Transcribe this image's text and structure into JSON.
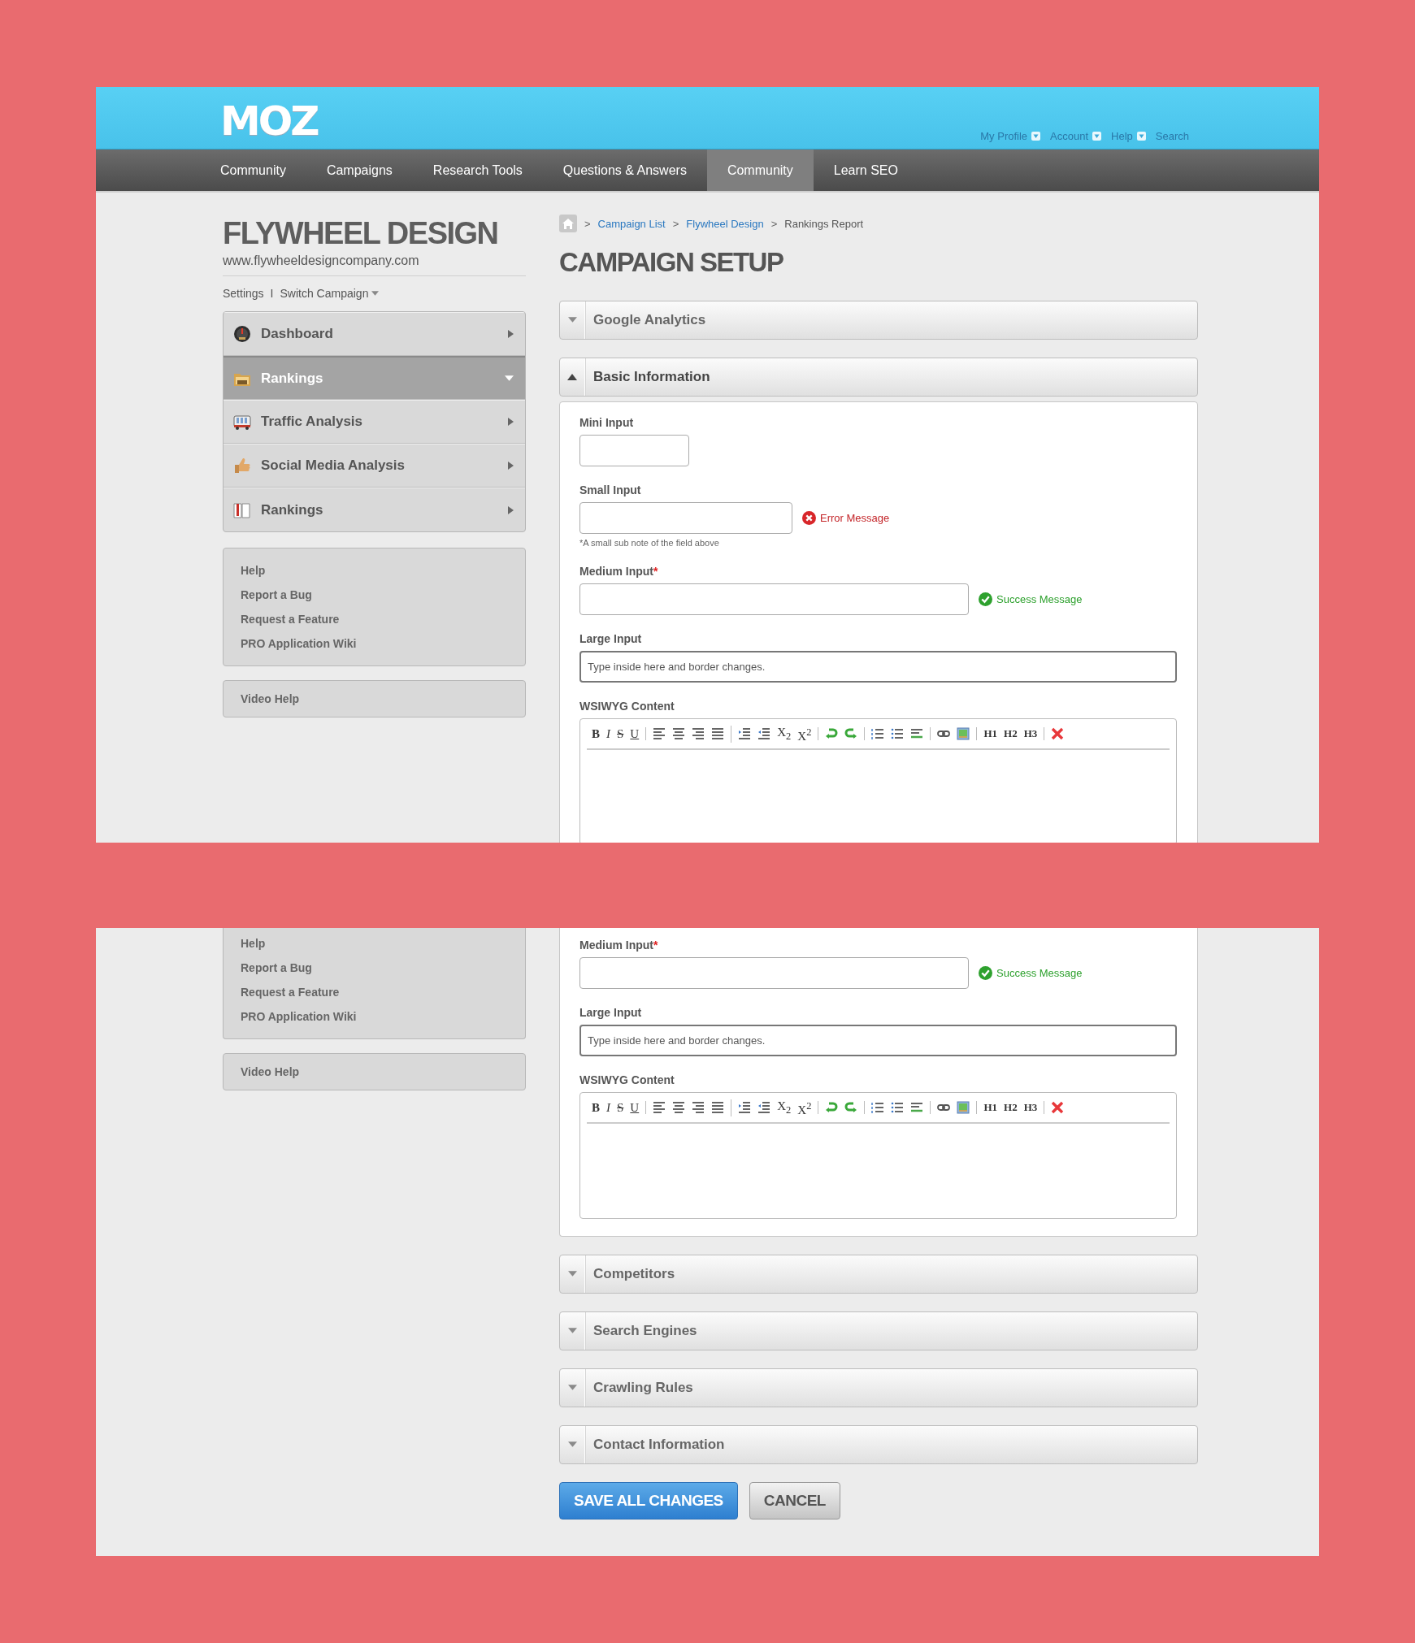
{
  "views": [
    {
      "kind": "top",
      "header": {
        "logo": "MOZ",
        "user_links": [
          {
            "label": "My Profile",
            "dropdown": true
          },
          {
            "label": "Account",
            "dropdown": true
          },
          {
            "label": "Help",
            "dropdown": true
          },
          {
            "label": "Search",
            "dropdown": false
          }
        ]
      },
      "nav": [
        {
          "label": "Community",
          "selected": false
        },
        {
          "label": "Campaigns",
          "selected": false
        },
        {
          "label": "Research Tools",
          "selected": false
        },
        {
          "label": "Questions & Answers",
          "selected": false
        },
        {
          "label": "Community",
          "selected": true
        },
        {
          "label": "Learn SEO",
          "selected": false
        }
      ],
      "sidebar": {
        "title": "FLYWHEEL DESIGN",
        "url": "www.flywheeldesigncompany.com",
        "settings": "Settings",
        "separator": "I",
        "switch_campaign": "Switch Campaign",
        "menu": [
          {
            "kind": "gauge",
            "label": "Dashboard",
            "selected": false
          },
          {
            "kind": "folder",
            "label": "Rankings",
            "selected": true
          },
          {
            "kind": "vehicle",
            "label": "Traffic Analysis",
            "selected": false
          },
          {
            "kind": "thumb",
            "label": "Social Media Analysis",
            "selected": false
          },
          {
            "kind": "book",
            "label": "Rankings",
            "selected": false
          }
        ],
        "help_links": [
          "Help",
          "Report a Bug",
          "Request a Feature",
          "PRO Application Wiki"
        ],
        "video_help": "Video Help"
      },
      "breadcrumb": [
        {
          "separator": ">",
          "label": "Campaign List",
          "link": true
        },
        {
          "separator": ">",
          "label": "Flywheel Design",
          "link": true
        },
        {
          "separator": ">",
          "label": "Rankings Report",
          "link": false
        }
      ],
      "title": "CAMPAIGN SETUP",
      "sections": [
        {
          "title": "Google Analytics",
          "expanded": false
        },
        {
          "title": "Basic Information",
          "expanded": true,
          "fields": [
            {
              "kind": "mini",
              "label": "Mini Input",
              "focused": false
            },
            {
              "kind": "small",
              "label": "Small Input",
              "focused": false,
              "message": {
                "kind": "error",
                "text": "Error Message"
              },
              "note": "*A small sub note of the field above"
            },
            {
              "kind": "medium",
              "label": "Medium Input",
              "required_mark": "*",
              "focused": false,
              "message": {
                "kind": "success",
                "text": "Success Message"
              }
            },
            {
              "kind": "large",
              "label": "Large Input",
              "focused": true,
              "placeholder": "Type inside here and border changes."
            },
            {
              "kind": "editor",
              "label": "WSIWYG Content",
              "toolbar": [
                [
                  {
                    "kind": "bold",
                    "label": "B"
                  },
                  {
                    "kind": "italic",
                    "label": "I"
                  },
                  {
                    "kind": "strike",
                    "label": "S"
                  },
                  {
                    "kind": "underline",
                    "label": "U"
                  }
                ],
                [
                  {
                    "kind": "align-left"
                  },
                  {
                    "kind": "align-center"
                  },
                  {
                    "kind": "align-right"
                  },
                  {
                    "kind": "justify"
                  }
                ],
                [
                  {
                    "kind": "indent"
                  },
                  {
                    "kind": "outdent"
                  },
                  {
                    "kind": "script",
                    "label": "X$_{2}$"
                  },
                  {
                    "kind": "script",
                    "label": "X$^{2}$"
                  }
                ],
                [
                  {
                    "kind": "undo"
                  },
                  {
                    "kind": "redo"
                  }
                ],
                [
                  {
                    "kind": "ordered-list"
                  },
                  {
                    "kind": "bullet-list"
                  },
                  {
                    "kind": "rule"
                  }
                ],
                [
                  {
                    "kind": "link"
                  },
                  {
                    "kind": "image"
                  }
                ],
                [
                  {
                    "kind": "heading",
                    "label": "H1"
                  },
                  {
                    "kind": "heading",
                    "label": "H2"
                  },
                  {
                    "kind": "heading",
                    "label": "H3"
                  }
                ],
                [
                  {
                    "kind": "clear"
                  }
                ]
              ]
            }
          ]
        }
      ]
    },
    {
      "kind": "scrolled",
      "sidebar": {
        "help_links": [
          "Help",
          "Report a Bug",
          "Request a Feature",
          "PRO Application Wiki"
        ],
        "video_help": "Video Help"
      },
      "sections": [
        {
          "continued": true,
          "expanded": true,
          "fields": [
            {
              "kind": "medium",
              "label": "Medium Input",
              "required_mark": "*",
              "focused": false,
              "message": {
                "kind": "success",
                "text": "Success Message"
              }
            },
            {
              "kind": "large",
              "label": "Large Input",
              "focused": true,
              "placeholder": "Type inside here and border changes."
            },
            {
              "kind": "editor",
              "label": "WSIWYG Content",
              "toolbar": [
                [
                  {
                    "kind": "bold",
                    "label": "B"
                  },
                  {
                    "kind": "italic",
                    "label": "I"
                  },
                  {
                    "kind": "strike",
                    "label": "S"
                  },
                  {
                    "kind": "underline",
                    "label": "U"
                  }
                ],
                [
                  {
                    "kind": "align-left"
                  },
                  {
                    "kind": "align-center"
                  },
                  {
                    "kind": "align-right"
                  },
                  {
                    "kind": "justify"
                  }
                ],
                [
                  {
                    "kind": "indent"
                  },
                  {
                    "kind": "outdent"
                  },
                  {
                    "kind": "script",
                    "label": "X$_{2}$"
                  },
                  {
                    "kind": "script",
                    "label": "X$^{2}$"
                  }
                ],
                [
                  {
                    "kind": "undo"
                  },
                  {
                    "kind": "redo"
                  }
                ],
                [
                  {
                    "kind": "ordered-list"
                  },
                  {
                    "kind": "bullet-list"
                  },
                  {
                    "kind": "rule"
                  }
                ],
                [
                  {
                    "kind": "link"
                  },
                  {
                    "kind": "image"
                  }
                ],
                [
                  {
                    "kind": "heading",
                    "label": "H1"
                  },
                  {
                    "kind": "heading",
                    "label": "H2"
                  },
                  {
                    "kind": "heading",
                    "label": "H3"
                  }
                ],
                [
                  {
                    "kind": "clear"
                  }
                ]
              ]
            }
          ]
        },
        {
          "title": "Competitors",
          "expanded": false
        },
        {
          "title": "Search Engines",
          "expanded": false
        },
        {
          "title": "Crawling Rules",
          "expanded": false
        },
        {
          "title": "Contact Information",
          "expanded": false
        }
      ],
      "buttons": [
        {
          "kind": "primary",
          "label": "SAVE ALL CHANGES"
        },
        {
          "kind": "secondary",
          "label": "CANCEL"
        }
      ]
    }
  ]
}
